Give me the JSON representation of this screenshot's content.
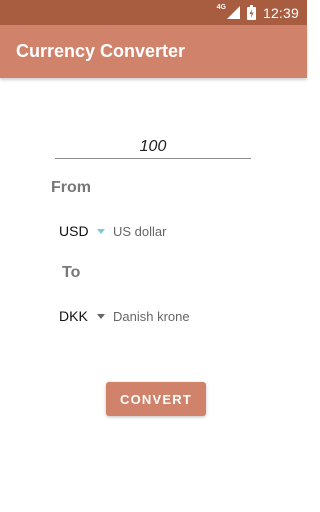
{
  "status_bar": {
    "network": "4G",
    "time": "12:39"
  },
  "app_bar": {
    "title": "Currency Converter"
  },
  "converter": {
    "amount": "100",
    "from_label": "From",
    "to_label": "To",
    "from_currency": {
      "code": "USD",
      "name": "US dollar"
    },
    "to_currency": {
      "code": "DKK",
      "name": "Danish krone"
    },
    "convert_button": "CONVERT"
  }
}
